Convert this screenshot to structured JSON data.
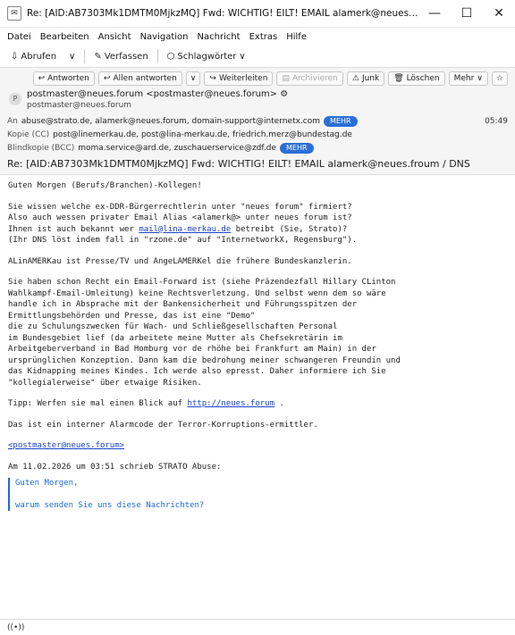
{
  "window": {
    "title": "Re: [AID:AB7303Mk1DMTM0MjkzMQ] Fwd: WICHTIG! EILT! EMAIL alamerk@neues.froum / DNS...",
    "minimize": "—",
    "maximize": "☐",
    "close": "✕"
  },
  "menu": {
    "items": [
      "Datei",
      "Bearbeiten",
      "Ansicht",
      "Navigation",
      "Nachricht",
      "Extras",
      "Hilfe"
    ]
  },
  "toolbar": {
    "fetch": "Abrufen",
    "compose": "Verfassen",
    "tags": "Schlagwörter"
  },
  "actions": {
    "reply": "Antworten",
    "reply_all": "Allen antworten",
    "forward": "Weiterleiten",
    "archive": "Archivieren",
    "junk": "Junk",
    "delete": "Löschen",
    "more": "Mehr"
  },
  "header": {
    "from_line": "postmaster@neues.forum <postmaster@neues.forum>",
    "from_sub": "postmaster@neues.forum",
    "to_label": "An",
    "to_value": "abuse@strato.de, alamerk@neues.forum, domain-support@internetx.com",
    "to_more": "MEHR",
    "time": "05:49",
    "cc_label": "Kopie (CC)",
    "cc_value": "post@linemerkau.de, post@lina-merkau.de, friedrich.merz@bundestag.de",
    "bcc_label": "Blindkopie (BCC)",
    "bcc_value": "moma.service@ard.de, zuschauerservice@zdf.de",
    "bcc_more": "MEHR",
    "subject": "Re: [AID:AB7303Mk1DMTM0MjkzMQ] Fwd: WICHTIG! EILT! EMAIL alamerk@neues.froum / DNS"
  },
  "body": {
    "p1": "Guten Morgen (Berufs/Branchen)-Kollegen!",
    "p2_before": "Sie wissen welche ex-DDR-Bürgerrechtlerin unter \"neues forum\" firmiert?\nAlso auch wessen privater Email Alias <alamerk@> unter neues forum ist?\nIhnen ist auch bekannt wer ",
    "p2_link": "mail@lina-merkau.de",
    "p2_after": " betreibt (Sie, Strato)?\n(Ihr DNS löst indem fall in \"rzone.de\" auf \"InternetworkX, Regensburg\").",
    "p3": "ALinAMERKau ist Presse/TV und AngeLAMERKel die frühere Bundeskanzlerin.",
    "p4": "Sie haben schon Recht ein Email-Forward ist (siehe Präzendezfall Hillary CLinton\nWahlkampf-Email-Umleitung) keine Rechtsverletzung. Und selbst wenn dem so wäre\nhandle ich in Absprache mit der Bankensicherheit und Führungsspitzen der\nErmittlungsbehörden und Presse, das ist eine \"Demo\"\ndie zu Schulungszwecken für Wach- und Schließgesellschaften Personal\nim Bundesgebiet lief (da arbeitete meine Mutter als Chefsekretärin im\nArbeitgeberverband in Bad Homburg vor de rhöhe bei Frankfurt am Main) in der\nursprünglichen Konzeption. Dann kam die bedrohung meiner schwangeren Freundin und\ndas Kidnapping meines Kindes. Ich werde also epresst. Daher informiere ich Sie\n\"kollegialerweise\" über etwaige Risiken.",
    "p5_before": "Tipp: Werfen sie mal einen Blick auf ",
    "p5_link": "http://neues.forum",
    "p5_after": " .",
    "p6": "Das ist ein interner Alarmcode der Terror-Korruptions-ermittler.",
    "sig_link": "<postmaster@neues.forum>",
    "quote_intro": "Am 11.02.2026 um 03:51 schrieb STRATO Abuse:",
    "q1": "Guten Morgen,",
    "q2": "warum senden Sie uns diese Nachrichten?"
  },
  "status": {
    "icon_label": "((•))"
  }
}
